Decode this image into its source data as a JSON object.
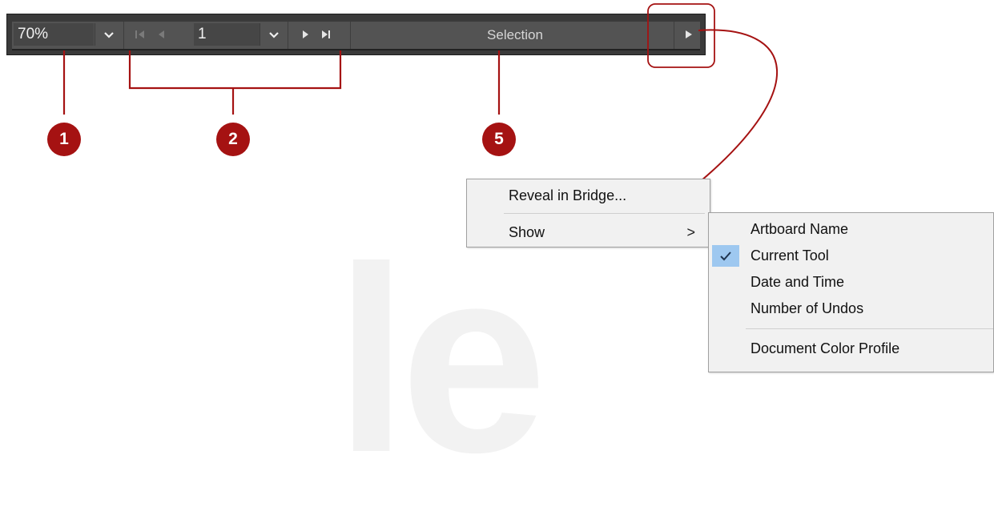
{
  "statusbar": {
    "zoom_value": "70%",
    "page_value": "1",
    "status_text": "Selection"
  },
  "callouts": [
    "1",
    "2",
    "5"
  ],
  "menu": {
    "items": [
      {
        "label": "Reveal in Bridge..."
      },
      {
        "label": "Show",
        "has_submenu": true
      }
    ],
    "submenu_arrow": ">"
  },
  "submenu": {
    "items": [
      {
        "label": "Artboard Name",
        "checked": false
      },
      {
        "label": "Current Tool",
        "checked": true
      },
      {
        "label": "Date and Time",
        "checked": false
      },
      {
        "label": "Number of Undos",
        "checked": false
      },
      {
        "label": "Document Color Profile",
        "checked": false
      }
    ]
  },
  "watermark": "le",
  "colors": {
    "callout_red": "#a51212",
    "bar_bg": "#535353",
    "menu_bg": "#f1f1f1",
    "check_highlight": "#9ec8f0"
  }
}
